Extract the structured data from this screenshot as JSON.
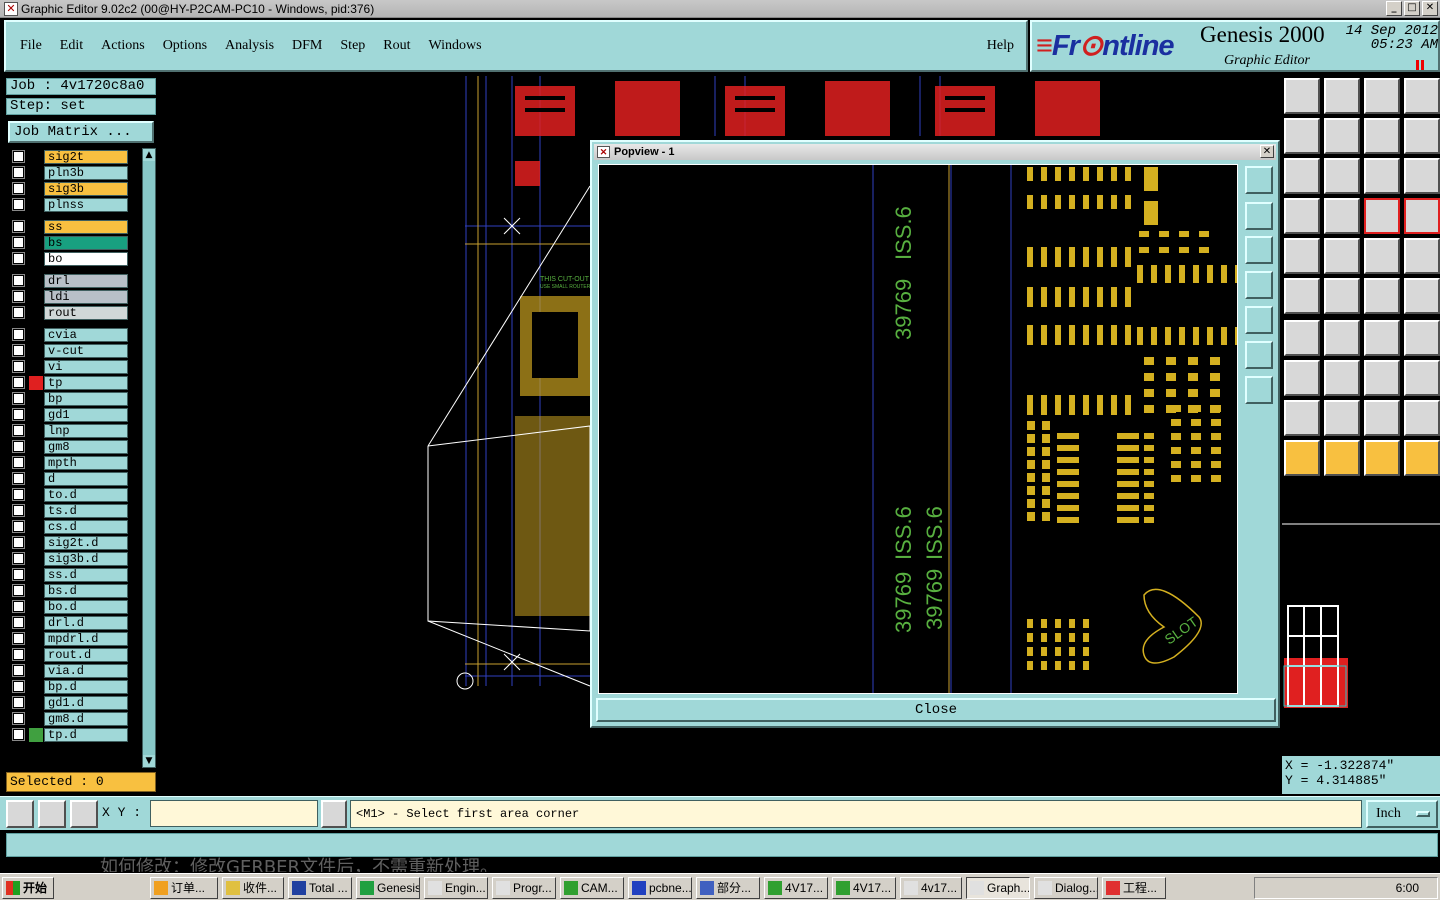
{
  "window": {
    "title": "Graphic Editor 9.02c2 (00@HY-P2CAM-PC10 - Windows, pid:376)"
  },
  "menu": {
    "items": [
      "File",
      "Edit",
      "Actions",
      "Options",
      "Analysis",
      "DFM",
      "Step",
      "Rout",
      "Windows"
    ],
    "help": "Help"
  },
  "brand": {
    "logo_a": "Fr",
    "logo_b": "ntline",
    "product": "Genesis 2000",
    "subtitle": "Graphic Editor",
    "date": "14 Sep 2012",
    "time": "05:23 AM"
  },
  "job": {
    "job_label": "Job : 4v1720c8a0",
    "step_label": "Step: set",
    "matrix_button": "Job Matrix ..."
  },
  "layers": [
    {
      "name": "sig2t",
      "color": "#f8c040",
      "sw": "#000"
    },
    {
      "name": "pln3b",
      "color": "#a0d8d8",
      "sw": "#000"
    },
    {
      "name": "sig3b",
      "color": "#f8c040",
      "sw": "#000"
    },
    {
      "name": "plnss",
      "color": "#a0d8d8",
      "sw": "#000"
    },
    {
      "name": "ss",
      "color": "#f8c040",
      "sw": "#000"
    },
    {
      "name": "bs",
      "color": "#18a080",
      "sw": "#000"
    },
    {
      "name": "bo",
      "color": "#ffffff",
      "sw": "#000"
    },
    {
      "name": "drl",
      "color": "#b8c0c8",
      "sw": "#000"
    },
    {
      "name": "ldi",
      "color": "#b8c0c8",
      "sw": "#000"
    },
    {
      "name": "rout",
      "color": "#d0d8d8",
      "sw": "#000"
    },
    {
      "name": "cvia",
      "color": "#a0d8d8",
      "sw": "#000"
    },
    {
      "name": "v-cut",
      "color": "#a0d8d8",
      "sw": "#000"
    },
    {
      "name": "vi",
      "color": "#a0d8d8",
      "sw": "#000"
    },
    {
      "name": "tp",
      "color": "#a0d8d8",
      "sw": "#e02020"
    },
    {
      "name": "bp",
      "color": "#a0d8d8",
      "sw": "#000"
    },
    {
      "name": "gd1",
      "color": "#a0d8d8",
      "sw": "#000"
    },
    {
      "name": "lnp",
      "color": "#a0d8d8",
      "sw": "#000"
    },
    {
      "name": "gm8",
      "color": "#a0d8d8",
      "sw": "#000"
    },
    {
      "name": "mpth",
      "color": "#a0d8d8",
      "sw": "#000"
    },
    {
      "name": "d",
      "color": "#a0d8d8",
      "sw": "#000"
    },
    {
      "name": "to.d",
      "color": "#a0d8d8",
      "sw": "#000"
    },
    {
      "name": "ts.d",
      "color": "#a0d8d8",
      "sw": "#000"
    },
    {
      "name": "cs.d",
      "color": "#a0d8d8",
      "sw": "#000"
    },
    {
      "name": "sig2t.d",
      "color": "#a0d8d8",
      "sw": "#000"
    },
    {
      "name": "sig3b.d",
      "color": "#a0d8d8",
      "sw": "#000"
    },
    {
      "name": "ss.d",
      "color": "#a0d8d8",
      "sw": "#000"
    },
    {
      "name": "bs.d",
      "color": "#a0d8d8",
      "sw": "#000"
    },
    {
      "name": "bo.d",
      "color": "#a0d8d8",
      "sw": "#000"
    },
    {
      "name": "drl.d",
      "color": "#a0d8d8",
      "sw": "#000"
    },
    {
      "name": "mpdrl.d",
      "color": "#a0d8d8",
      "sw": "#000"
    },
    {
      "name": "rout.d",
      "color": "#a0d8d8",
      "sw": "#000"
    },
    {
      "name": "via.d",
      "color": "#a0d8d8",
      "sw": "#000"
    },
    {
      "name": "bp.d",
      "color": "#a0d8d8",
      "sw": "#000"
    },
    {
      "name": "gd1.d",
      "color": "#a0d8d8",
      "sw": "#000"
    },
    {
      "name": "gm8.d",
      "color": "#a0d8d8",
      "sw": "#000"
    },
    {
      "name": "tp.d",
      "color": "#a0d8d8",
      "sw": "#40a040"
    }
  ],
  "selected": "Selected : 0",
  "popview": {
    "title": "Popview - 1",
    "close_label": "Close",
    "labels": {
      "a": "ISS.6",
      "b": "39769",
      "c": "ISS.6",
      "d": "39769",
      "e": "ISS.6",
      "f": "39769",
      "slot": "SLOT"
    }
  },
  "board_text": {
    "note1": "THIS CUT-OUT",
    "note2": "USE SMALL ROUTER"
  },
  "coords": {
    "x": "X = -1.322874\"",
    "y": "Y = 4.314885\""
  },
  "cmd": {
    "xy_label": "X Y :",
    "xy_value": "",
    "prompt": "<M1> - Select first area corner",
    "unit": "Inch"
  },
  "background_text": "如何修改：修改GERBER文件后，不需重新处理。",
  "taskbar": {
    "start": "开始",
    "tasks": [
      "订单...",
      "收件...",
      "Total ...",
      "Genesis",
      "Engin...",
      "Progr...",
      "CAM...",
      "pcbne...",
      "部分...",
      "4V17...",
      "4V17...",
      "4v17...",
      "Graph...",
      "Dialog...",
      "工程..."
    ],
    "clock": "6:00"
  },
  "colors": {
    "panel": "#a0d8d8",
    "pad": "#d4b020",
    "text_green": "#58b040",
    "guide": "#3040c0",
    "red_pad": "#e02020"
  }
}
